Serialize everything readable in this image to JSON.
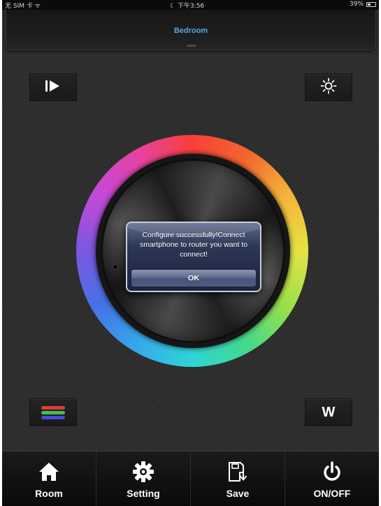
{
  "status_bar": {
    "carrier": "无 SIM 卡 ᯤ",
    "time": "☾ 下午3:56",
    "battery": "39%"
  },
  "header": {
    "title": "Bedroom"
  },
  "controls": {
    "top_left_icon": "play-step-icon",
    "top_right_icon": "brightness-icon",
    "bottom_left_icon": "rgb-lines-icon",
    "bottom_right_label": "W"
  },
  "colors": {
    "accent": "#5aa6df",
    "rgb_red": "#e03a3a",
    "rgb_green": "#3cc24a",
    "rgb_blue": "#4a4ad8"
  },
  "dialog": {
    "message": "Configure successfully!Connect smartphone to router you want to connect!",
    "ok_label": "OK"
  },
  "tabbar": {
    "items": [
      {
        "label": "Room",
        "icon": "home-icon"
      },
      {
        "label": "Setting",
        "icon": "gear-icon"
      },
      {
        "label": "Save",
        "icon": "save-icon"
      },
      {
        "label": "ON/OFF",
        "icon": "power-icon"
      }
    ]
  }
}
